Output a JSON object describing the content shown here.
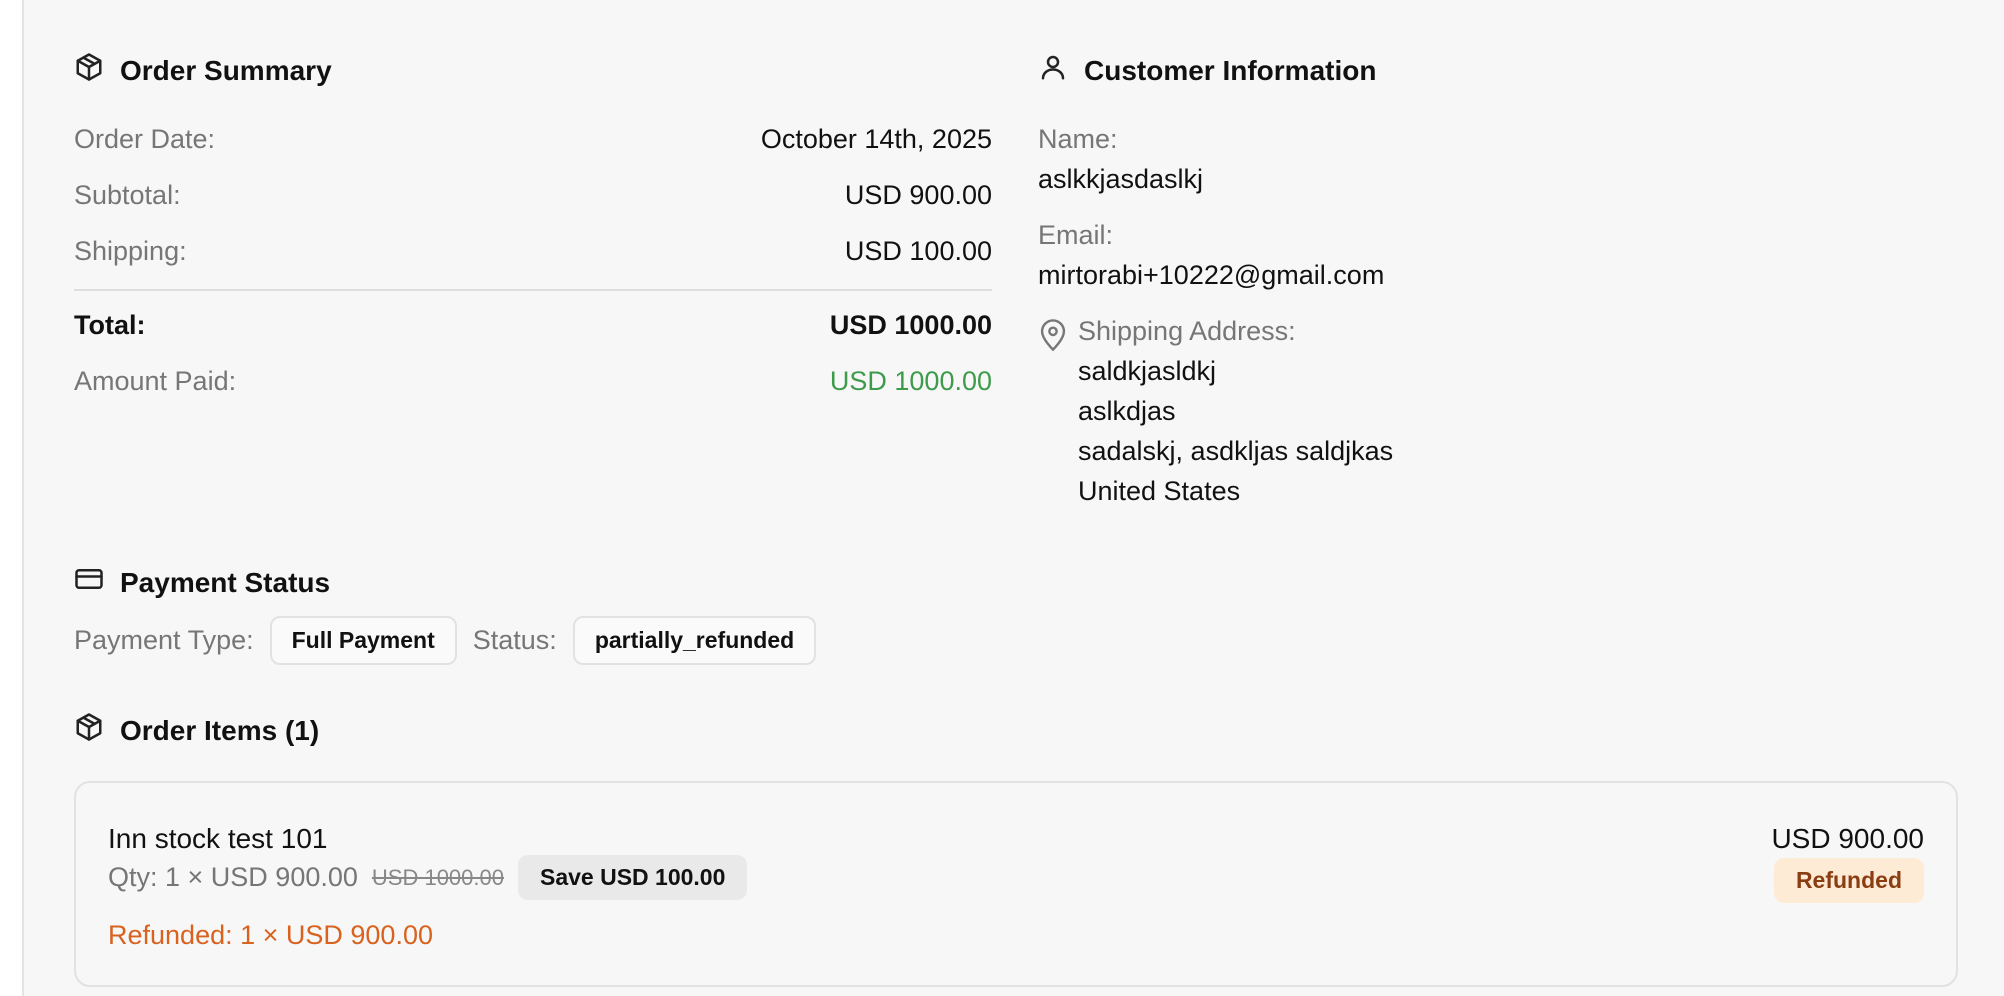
{
  "order_summary": {
    "title": "Order Summary",
    "rows": [
      {
        "label": "Order Date:",
        "value": "October 14th, 2025"
      },
      {
        "label": "Subtotal:",
        "value": "USD 900.00"
      },
      {
        "label": "Shipping:",
        "value": "USD 100.00"
      }
    ],
    "total": {
      "label": "Total:",
      "value": "USD 1000.00"
    },
    "amount_paid": {
      "label": "Amount Paid:",
      "value": "USD 1000.00"
    }
  },
  "customer": {
    "title": "Customer Information",
    "name_label": "Name:",
    "name": "aslkkjasdaslkj",
    "email_label": "Email:",
    "email": "mirtorabi+10222@gmail.com",
    "address_label": "Shipping Address:",
    "address_lines": [
      "saldkjasldkj",
      "aslkdjas",
      "sadalskj, asdkljas saldjkas",
      "United States"
    ]
  },
  "payment": {
    "title": "Payment Status",
    "type_label": "Payment Type:",
    "type": "Full Payment",
    "status_label": "Status:",
    "status": "partially_refunded"
  },
  "items": {
    "title": "Order Items (1)",
    "list": [
      {
        "name": "Inn stock test 101",
        "qty": "Qty: 1 × USD 900.00",
        "original_price": "USD 1000.00",
        "save": "Save USD 100.00",
        "refunded": "Refunded: 1 × USD 900.00",
        "price": "USD 900.00",
        "badge": "Refunded"
      }
    ]
  },
  "colors": {
    "paid": "#3e9b4b",
    "refunded_text": "#d9621f",
    "refund_badge_bg": "#fdebd6"
  }
}
